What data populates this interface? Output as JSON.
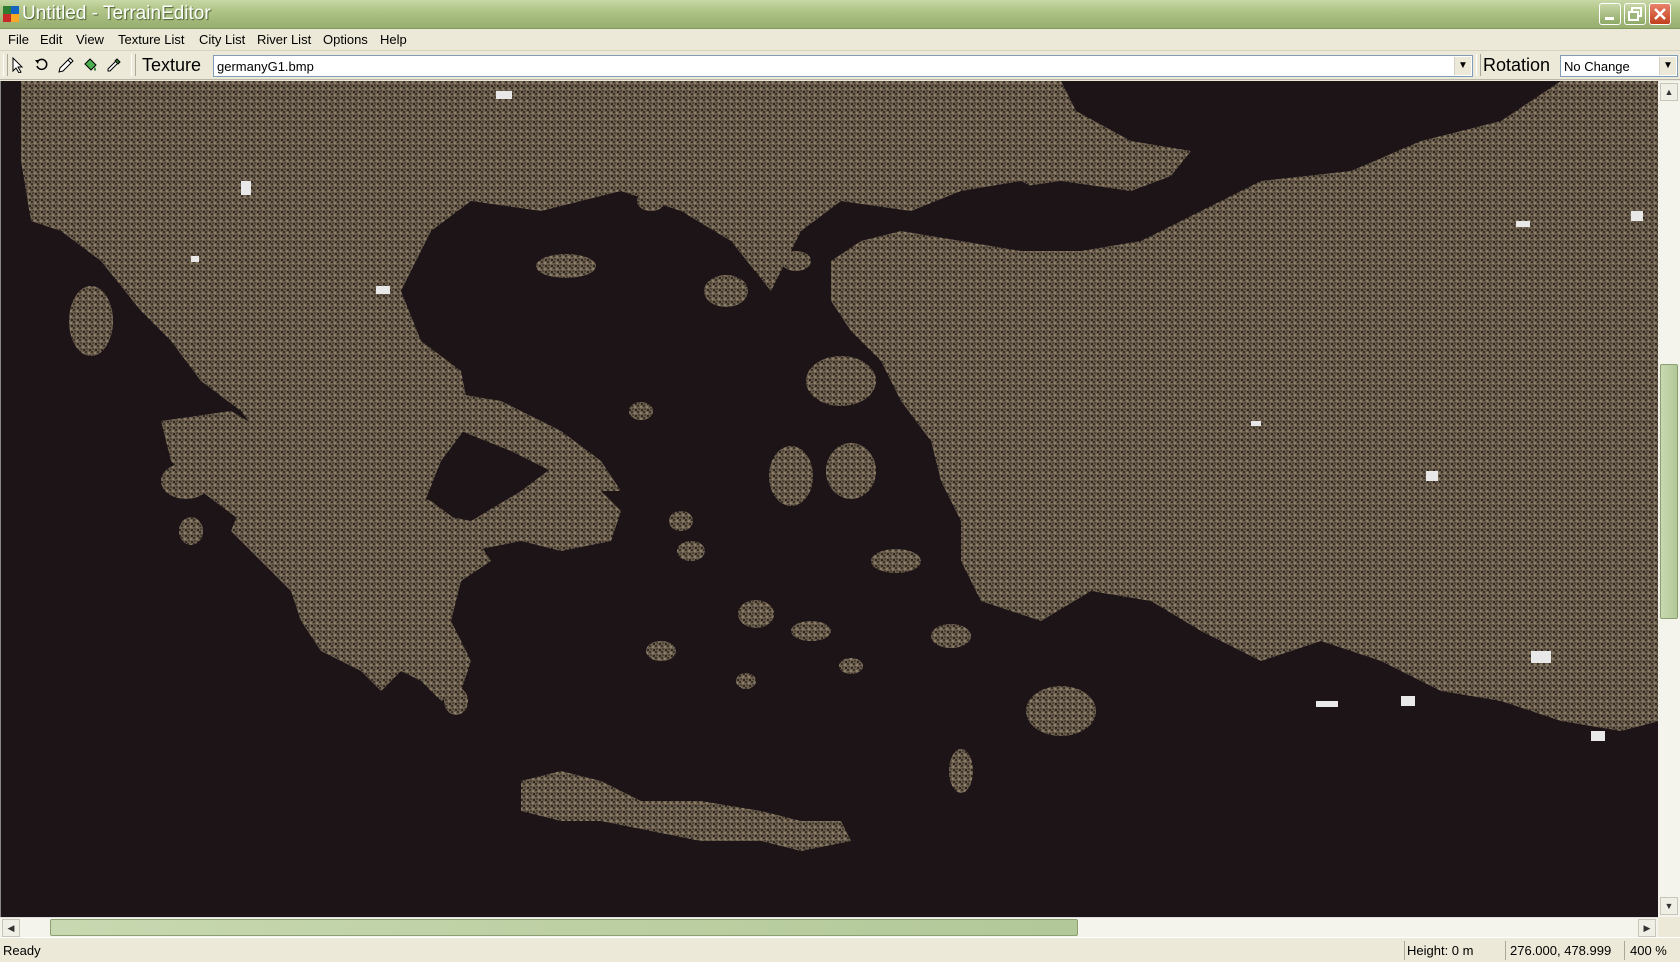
{
  "window": {
    "title": "Untitled - TerrainEditor"
  },
  "menu": [
    "File",
    "Edit",
    "View",
    "Texture List",
    "City List",
    "River List",
    "Options",
    "Help"
  ],
  "toolbar": {
    "tools": [
      "select-tool",
      "rotate-tool",
      "pencil-tool",
      "fill-tool",
      "eyedropper-tool"
    ],
    "texture_label": "Texture",
    "texture_value": "germanyG1.bmp",
    "rotation_label": "Rotation",
    "rotation_value": "No Change"
  },
  "status": {
    "left": "Ready",
    "height": "Height: 0 m",
    "coords": "276.000, 478.999",
    "zoom": "400 %"
  },
  "map": {
    "water_color": "#1d1418",
    "land_color": "#6b5d4c",
    "snow_color": "#e8e8e8"
  }
}
